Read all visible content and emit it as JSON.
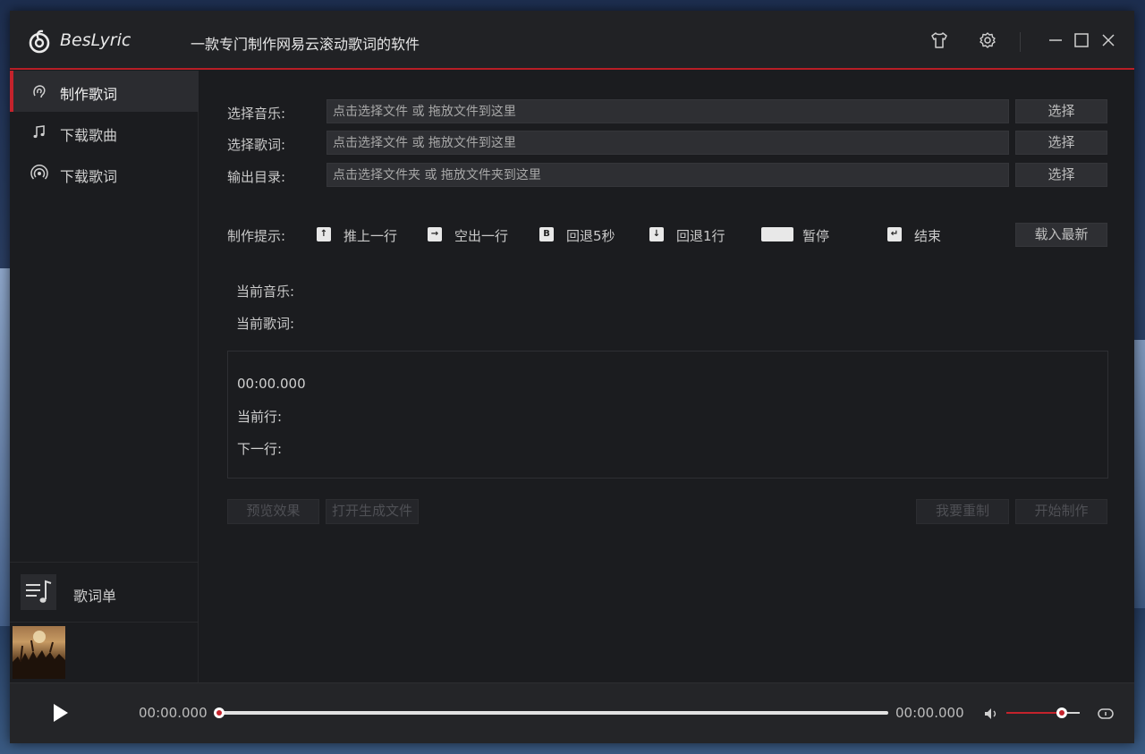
{
  "app": {
    "name": "BesLyric",
    "subtitle": "一款专门制作网易云滚动歌词的软件"
  },
  "titlebar": {
    "icons": [
      "skin-icon",
      "settings-icon",
      "minimize-icon",
      "maximize-icon",
      "close-icon"
    ]
  },
  "sidebar": {
    "items": [
      {
        "label": "制作歌词",
        "icon": "make-lyric-icon",
        "active": true
      },
      {
        "label": "下载歌曲",
        "icon": "music-note-icon",
        "active": false
      },
      {
        "label": "下载歌词",
        "icon": "broadcast-icon",
        "active": false
      }
    ],
    "playlist_label": "歌词单"
  },
  "form": {
    "music_label": "选择音乐:",
    "music_placeholder": "点击选择文件 或 拖放文件到这里",
    "lyric_label": "选择歌词:",
    "lyric_placeholder": "点击选择文件 或 拖放文件到这里",
    "output_label": "输出目录:",
    "output_placeholder": "点击选择文件夹 或 拖放文件夹到这里",
    "choose_label": "选择"
  },
  "hints": {
    "label": "制作提示:",
    "items": [
      {
        "key": "↑",
        "text": "推上一行"
      },
      {
        "key": "→",
        "text": "空出一行"
      },
      {
        "key": "B",
        "text": "回退5秒"
      },
      {
        "key": "↓",
        "text": "回退1行"
      },
      {
        "key": "",
        "text": "暂停"
      },
      {
        "key": "↵",
        "text": "结束"
      }
    ],
    "load_latest": "载入最新"
  },
  "current": {
    "music_label": "当前音乐:",
    "lyric_label": "当前歌词:"
  },
  "lyric_box": {
    "time": "00:00.000",
    "current_line_label": "当前行:",
    "next_line_label": "下一行:"
  },
  "actions": {
    "preview": "预览效果",
    "open_file": "打开生成文件",
    "reset": "我要重制",
    "start": "开始制作"
  },
  "player": {
    "current_time": "00:00.000",
    "total_time": "00:00.000",
    "progress": 0,
    "volume": 0.75,
    "accent": "#c4232c"
  }
}
